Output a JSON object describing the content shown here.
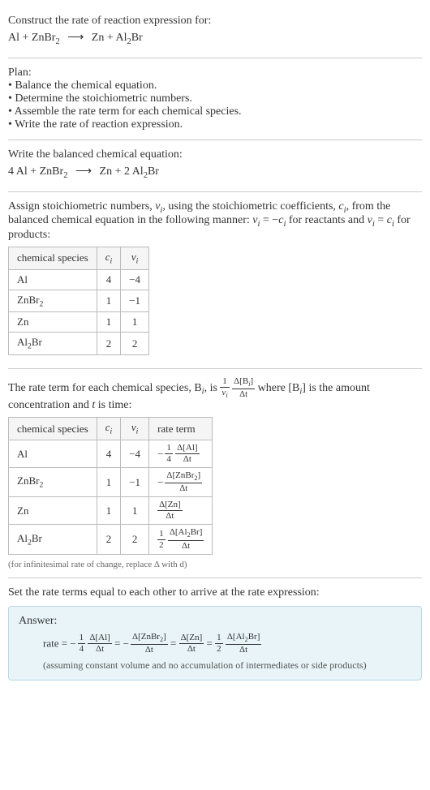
{
  "prompt": {
    "line1": "Construct the rate of reaction expression for:",
    "equation_lhs": "Al + ZnBr",
    "equation_sub1": "2",
    "equation_arrow": "⟶",
    "equation_rhs": "Zn + Al",
    "equation_sub2": "2",
    "equation_tail": "Br"
  },
  "plan": {
    "heading": "Plan:",
    "items": [
      "Balance the chemical equation.",
      "Determine the stoichiometric numbers.",
      "Assemble the rate term for each chemical species.",
      "Write the rate of reaction expression."
    ]
  },
  "balanced": {
    "heading": "Write the balanced chemical equation:",
    "lhs1": "4 Al + ZnBr",
    "sub1": "2",
    "arrow": "⟶",
    "rhs1": "Zn + 2 Al",
    "sub2": "2",
    "tail": "Br"
  },
  "stoich_text": {
    "part1": "Assign stoichiometric numbers, ",
    "nu": "ν",
    "i": "i",
    "part2": ", using the stoichiometric coefficients, ",
    "c": "c",
    "part3": ", from the balanced chemical equation in the following manner: ",
    "eq1_lhs": "ν",
    "eq1_mid": " = −",
    "eq1_rhs": "c",
    "part4": " for reactants and ",
    "eq2": " = ",
    "part5": " for products:"
  },
  "stoich_table": {
    "headers": [
      "chemical species",
      "cᵢ",
      "νᵢ"
    ],
    "rows": [
      {
        "species": "Al",
        "c": "4",
        "nu": "−4"
      },
      {
        "species_pre": "ZnBr",
        "species_sub": "2",
        "c": "1",
        "nu": "−1"
      },
      {
        "species": "Zn",
        "c": "1",
        "nu": "1"
      },
      {
        "species_pre": "Al",
        "species_sub": "2",
        "species_post": "Br",
        "c": "2",
        "nu": "2"
      }
    ]
  },
  "rate_term_text": {
    "part1": "The rate term for each chemical species, B",
    "part2": ", is ",
    "frac1_num": "1",
    "frac1_den_pre": "ν",
    "frac2_num_pre": "Δ[B",
    "frac2_num_post": "]",
    "frac2_den": "Δt",
    "part3": " where [B",
    "part4": "] is the amount concentration and ",
    "t": "t",
    "part5": " is time:"
  },
  "rate_table": {
    "headers": [
      "chemical species",
      "cᵢ",
      "νᵢ",
      "rate term"
    ],
    "rows": [
      {
        "species": "Al",
        "c": "4",
        "nu": "−4",
        "sign": "−",
        "coef_num": "1",
        "coef_den": "4",
        "conc_num": "Δ[Al]",
        "conc_den": "Δt"
      },
      {
        "species_pre": "ZnBr",
        "species_sub": "2",
        "c": "1",
        "nu": "−1",
        "sign": "−",
        "conc_num_pre": "Δ[ZnBr",
        "conc_num_sub": "2",
        "conc_num_post": "]",
        "conc_den": "Δt"
      },
      {
        "species": "Zn",
        "c": "1",
        "nu": "1",
        "conc_num": "Δ[Zn]",
        "conc_den": "Δt"
      },
      {
        "species_pre": "Al",
        "species_sub": "2",
        "species_post": "Br",
        "c": "2",
        "nu": "2",
        "coef_num": "1",
        "coef_den": "2",
        "conc_num_pre": "Δ[Al",
        "conc_num_sub": "2",
        "conc_num_post": "Br]",
        "conc_den": "Δt"
      }
    ],
    "footnote": "(for infinitesimal rate of change, replace Δ with d)"
  },
  "final": {
    "heading": "Set the rate terms equal to each other to arrive at the rate expression:"
  },
  "answer": {
    "label": "Answer:",
    "rate_prefix": "rate = ",
    "eq": " = ",
    "terms": [
      {
        "sign": "−",
        "coef_num": "1",
        "coef_den": "4",
        "conc_num": "Δ[Al]",
        "conc_den": "Δt"
      },
      {
        "sign": "−",
        "conc_num_pre": "Δ[ZnBr",
        "conc_num_sub": "2",
        "conc_num_post": "]",
        "conc_den": "Δt"
      },
      {
        "conc_num": "Δ[Zn]",
        "conc_den": "Δt"
      },
      {
        "coef_num": "1",
        "coef_den": "2",
        "conc_num_pre": "Δ[Al",
        "conc_num_sub": "2",
        "conc_num_post": "Br]",
        "conc_den": "Δt"
      }
    ],
    "note": "(assuming constant volume and no accumulation of intermediates or side products)"
  }
}
